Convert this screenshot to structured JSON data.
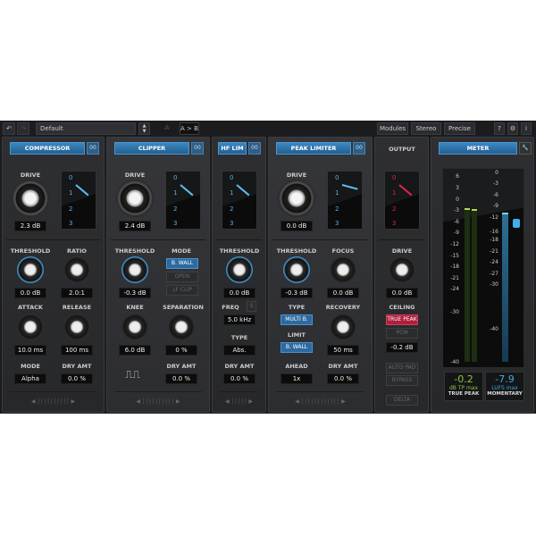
{
  "toolbar": {
    "preset": "Default",
    "a_label": "A",
    "ab_label": "A > B",
    "modules": "Modules",
    "stereo": "Stereo",
    "precise": "Precise",
    "help": "?",
    "info": "i"
  },
  "compressor": {
    "title": "COMPRESSOR",
    "link": "00",
    "drive_label": "DRIVE",
    "drive": "2.3 dB",
    "threshold_label": "THRESHOLD",
    "threshold": "0.0 dB",
    "ratio_label": "RATIO",
    "ratio": "2.0:1",
    "attack_label": "ATTACK",
    "attack": "10.0 ms",
    "release_label": "RELEASE",
    "release": "100 ms",
    "mode_label": "MODE",
    "mode": "Alpha",
    "dry_label": "DRY AMT",
    "dry": "0.0 %"
  },
  "clipper": {
    "title": "CLIPPER",
    "link": "00",
    "drive_label": "DRIVE",
    "drive": "2.4 dB",
    "threshold_label": "THRESHOLD",
    "threshold": "-0.3 dB",
    "mode_label": "MODE",
    "modes": [
      "B. WALL",
      "OPEN",
      "LF CLIP"
    ],
    "knee_label": "KNEE",
    "knee": "6.0 dB",
    "separation_label": "SEPARATION",
    "separation": "0 %",
    "dry_label": "DRY AMT",
    "dry": "0.0 %"
  },
  "hflim": {
    "title": "HF LIM",
    "link": "00",
    "threshold_label": "THRESHOLD",
    "threshold": "0.0 dB",
    "freq_label": "FREQ",
    "freq_btn": "S",
    "freq": "5.0 kHz",
    "type_label": "TYPE",
    "type": "Abs.",
    "dry_label": "DRY AMT",
    "dry": "0.0 %"
  },
  "limiter": {
    "title": "PEAK LIMITER",
    "link": "00",
    "drive_label": "DRIVE",
    "drive": "0.0 dB",
    "threshold_label": "THRESHOLD",
    "threshold": "-0.3 dB",
    "focus_label": "FOCUS",
    "focus": "0.0 dB",
    "type_label": "TYPE",
    "type": "MULTI B.",
    "limit_label": "LIMIT",
    "limit": "B. WALL",
    "recovery_label": "RECOVERY",
    "recovery": "50 ms",
    "ahead_label": "AHEAD",
    "ahead": "1x",
    "dry_label": "DRY AMT",
    "dry": "0.0 %"
  },
  "output": {
    "title": "OUTPUT",
    "drive_label": "DRIVE",
    "drive": "0.0 dB",
    "ceiling_label": "CEILING",
    "true_peak": "TRUE PEAK",
    "pcm": "PCM",
    "ceiling": "-0.2 dB",
    "auto_pad": "AUTO PAD",
    "bypass": "BYPASS",
    "delta": "DELTA"
  },
  "gr_scale": [
    "0",
    "1",
    "2",
    "3"
  ],
  "meter": {
    "title": "METER",
    "left_scale": [
      "6",
      "3",
      "0",
      "-3",
      "-6",
      "-9",
      "-12",
      "-15",
      "-18",
      "-21",
      "-24",
      "-30",
      "-40"
    ],
    "right_scale": [
      "0",
      "-3",
      "-6",
      "-9",
      "-12",
      "-16",
      "-18",
      "-21",
      "-24",
      "-27",
      "-30",
      "-40"
    ],
    "true_peak_value": "-0.2",
    "true_peak_unit": "dB TP max",
    "true_peak_label": "TRUE PEAK",
    "momentary_value": "-7.9",
    "momentary_unit": "LUFS max",
    "momentary_label": "MOMENTARY",
    "colors": {
      "peak": "#8bc34a",
      "loudness": "#3fa9e0"
    }
  }
}
